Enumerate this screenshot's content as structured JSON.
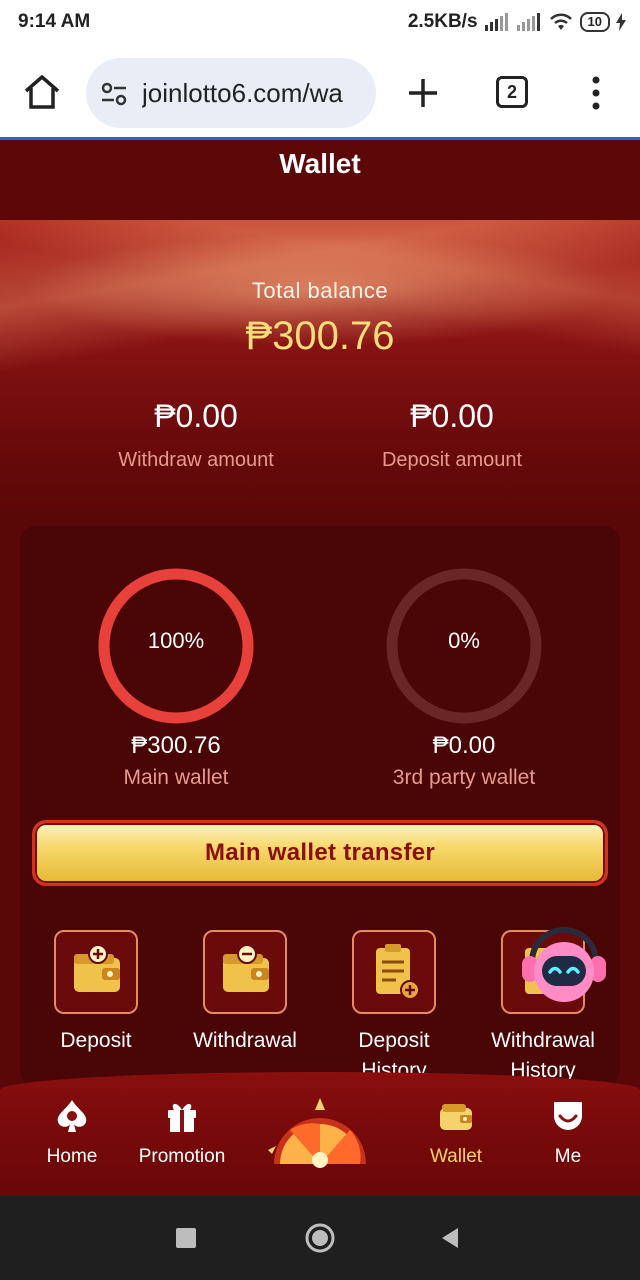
{
  "status_bar": {
    "time": "9:14 AM",
    "network_speed": "2.5KB/s",
    "battery": "10"
  },
  "browser": {
    "url": "joinlotto6.com/wa",
    "tab_count": "2"
  },
  "header": {
    "title": "Wallet"
  },
  "balance": {
    "total_label": "Total balance",
    "total_value": "₱300.76",
    "withdraw_value": "₱0.00",
    "withdraw_label": "Withdraw amount",
    "deposit_value": "₱0.00",
    "deposit_label": "Deposit amount"
  },
  "wallets": {
    "main": {
      "percent_label": "100%",
      "percent": 100,
      "value": "₱300.76",
      "label": "Main wallet"
    },
    "third": {
      "percent_label": "0%",
      "percent": 0,
      "value": "₱0.00",
      "label": "3rd party wallet"
    }
  },
  "transfer_button": "Main wallet transfer",
  "quick_actions": [
    {
      "label": "Deposit"
    },
    {
      "label": "Withdrawal"
    },
    {
      "label": "Deposit History"
    },
    {
      "label": "Withdrawal History"
    }
  ],
  "bottom_nav": {
    "items": [
      {
        "label": "Home"
      },
      {
        "label": "Promotion"
      },
      {
        "label": "Wallet"
      },
      {
        "label": "Me"
      }
    ],
    "active": "Wallet"
  },
  "colors": {
    "accent_gold": "#f8dd7a",
    "background_red": "#5c0708",
    "card_red": "#4a0506",
    "ring_active": "#e8403a",
    "ring_inactive": "#6a2526"
  }
}
